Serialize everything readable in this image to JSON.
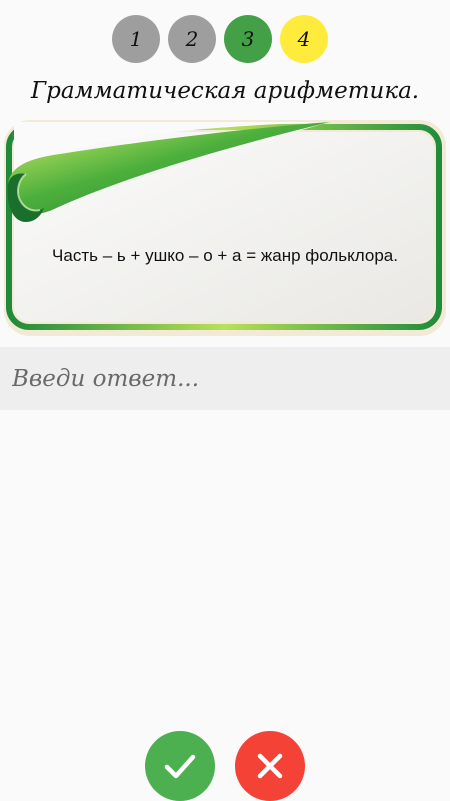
{
  "steps": [
    {
      "label": "1",
      "state": "done",
      "color": "#9e9e9e"
    },
    {
      "label": "2",
      "state": "done",
      "color": "#9e9e9e"
    },
    {
      "label": "3",
      "state": "current",
      "color": "#43a047"
    },
    {
      "label": "4",
      "state": "next",
      "color": "#ffeb3b"
    }
  ],
  "title": "Грамматическая арифметика.",
  "riddle": "Часть – ь + ушко – о + а = жанр фольклора.",
  "answer": {
    "value": "",
    "placeholder": "Введи ответ..."
  },
  "actions": {
    "confirm_icon": "check-icon",
    "cancel_icon": "close-icon",
    "confirm_color": "#4caf50",
    "cancel_color": "#f44336"
  },
  "card": {
    "frame_color": "#2e9e3e",
    "paper_color": "#f2f1ee"
  }
}
